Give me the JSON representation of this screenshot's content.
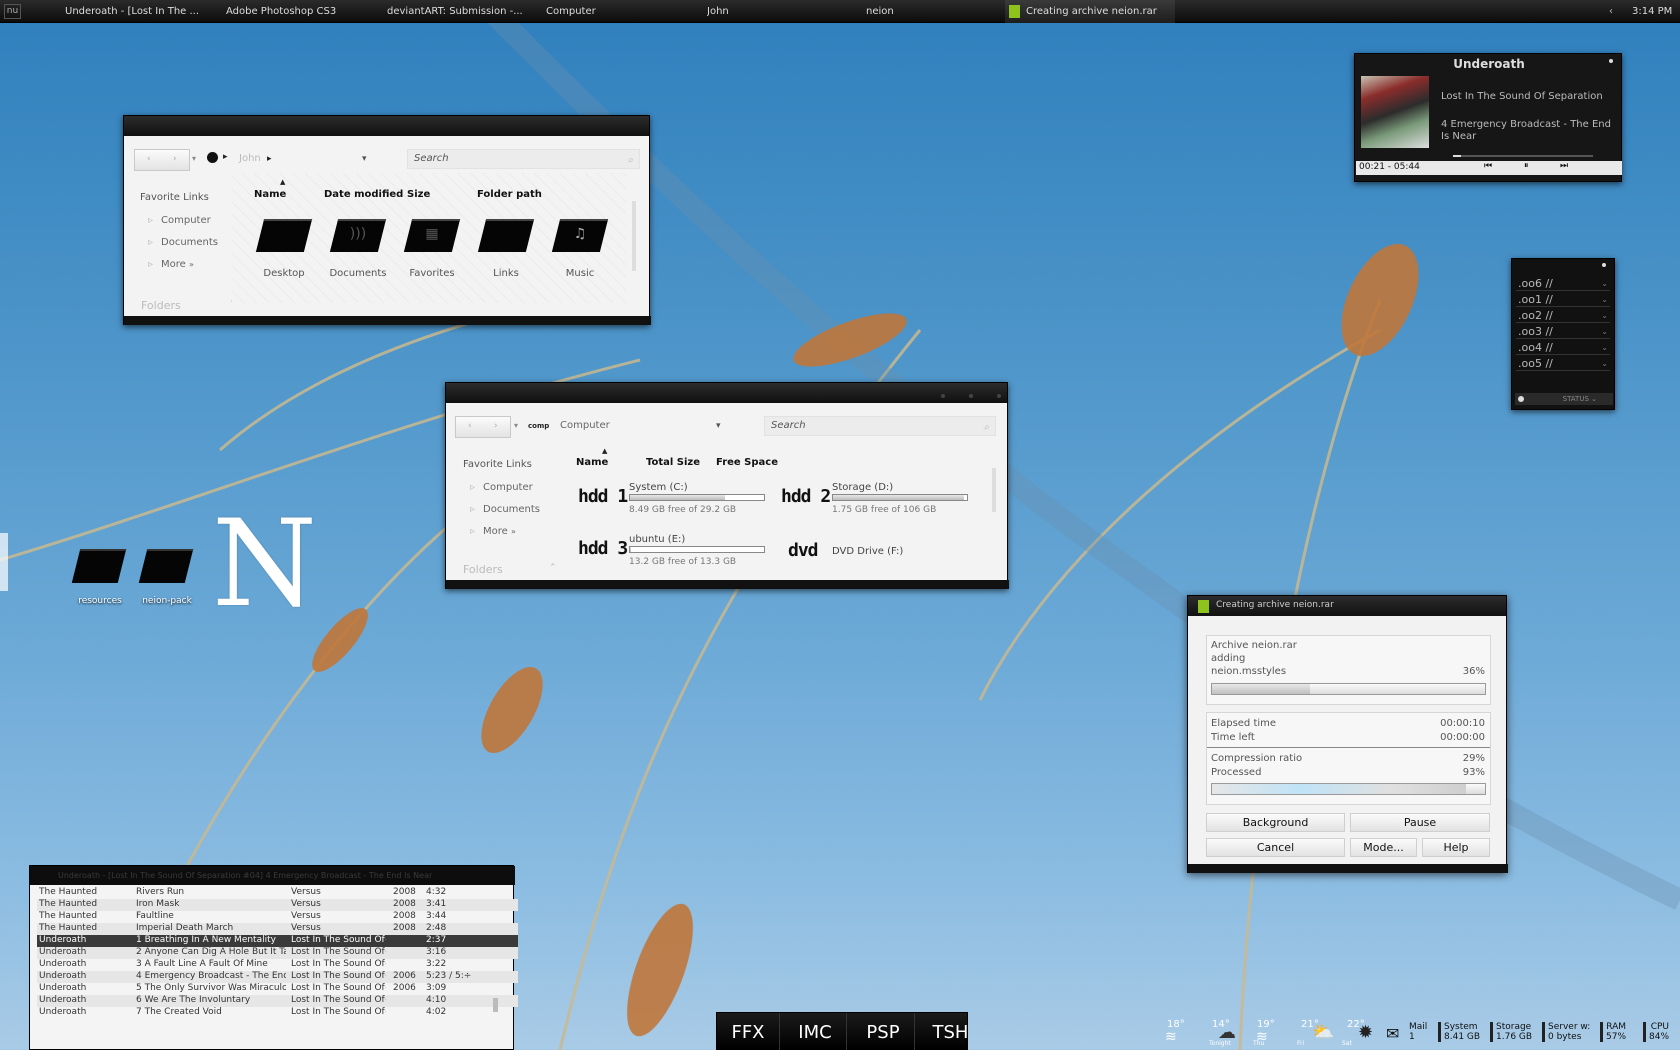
{
  "taskbar": {
    "start_label": "nu",
    "items": [
      {
        "label": "Underoath - [Lost In The ..."
      },
      {
        "label": "Adobe Photoshop CS3"
      },
      {
        "label": "deviantART: Submission -..."
      },
      {
        "label": "Computer"
      },
      {
        "label": "John"
      },
      {
        "label": "neion"
      },
      {
        "label": "Creating archive neion.rar"
      }
    ],
    "clock": "3:14 PM"
  },
  "explorer_john": {
    "address": "John",
    "search_placeholder": "Search",
    "favorite_links_title": "Favorite Links",
    "favorites": [
      "Computer",
      "Documents",
      "More"
    ],
    "columns": [
      "Name",
      "Date modified",
      "Size",
      "Folder path"
    ],
    "items": [
      {
        "label": "Desktop",
        "icon": "folder-icon"
      },
      {
        "label": "Documents",
        "icon": "folder-wifi-icon"
      },
      {
        "label": "Favorites",
        "icon": "folder-windows-icon"
      },
      {
        "label": "Links",
        "icon": "folder-icon"
      },
      {
        "label": "Music",
        "icon": "folder-music-icon"
      }
    ],
    "folders_label": "Folders"
  },
  "explorer_computer": {
    "address_prefix": "comp",
    "address": "Computer",
    "search_placeholder": "Search",
    "favorite_links_title": "Favorite Links",
    "favorites": [
      "Computer",
      "Documents",
      "More"
    ],
    "columns": [
      "Name",
      "Total Size",
      "Free Space"
    ],
    "drives": [
      {
        "icon": "hdd 1",
        "name": "System (C:)",
        "free": "8.49 GB free of 29.2 GB",
        "used_fraction": 0.71
      },
      {
        "icon": "hdd 2",
        "name": "Storage (D:)",
        "free": "1.75 GB free of 106 GB",
        "used_fraction": 0.98
      },
      {
        "icon": "hdd 3",
        "name": "ubuntu (E:)",
        "free": "13.2 GB free of 13.3 GB",
        "used_fraction": 0.01
      },
      {
        "icon": "dvd",
        "name": "DVD Drive (F:)"
      }
    ],
    "folders_label": "Folders"
  },
  "player": {
    "artist": "Underoath",
    "album": "Lost In The Sound Of Separation",
    "track": "4 Emergency Broadcast - The End Is Near",
    "time": "00:21 - 05:44",
    "progress_fraction": 0.06
  },
  "panel": {
    "items": [
      ".oo6 //",
      ".oo1 //",
      ".oo2 //",
      ".oo3 //",
      ".oo4 //",
      ".oo5 //"
    ],
    "status_label": "STATUS"
  },
  "rar": {
    "title": "Creating archive neion.rar",
    "archive": "Archive neion.rar",
    "action": "adding",
    "file": "neion.msstyles",
    "file_percent": "36%",
    "file_progress_fraction": 0.36,
    "elapsed_label": "Elapsed time",
    "elapsed": "00:00:10",
    "left_label": "Time left",
    "left": "00:00:00",
    "ratio_label": "Compression ratio",
    "ratio": "29%",
    "processed_label": "Processed",
    "processed": "93%",
    "processed_fraction": 0.93,
    "buttons": {
      "background": "Background",
      "pause": "Pause",
      "cancel": "Cancel",
      "mode": "Mode...",
      "help": "Help"
    }
  },
  "playlist": {
    "title": "Underoath - [Lost In The Sound Of Separation #04] 4 Emergency Broadcast - The End Is Near",
    "rows": [
      {
        "artist": "The Haunted",
        "title": "Rivers Run",
        "album": "Versus",
        "year": "2008",
        "length": "4:32"
      },
      {
        "artist": "The Haunted",
        "title": "Iron Mask",
        "album": "Versus",
        "year": "2008",
        "length": "3:41"
      },
      {
        "artist": "The Haunted",
        "title": "Faultline",
        "album": "Versus",
        "year": "2008",
        "length": "3:44"
      },
      {
        "artist": "The Haunted",
        "title": "Imperial Death March",
        "album": "Versus",
        "year": "2008",
        "length": "2:48"
      },
      {
        "artist": "Underoath",
        "title": "1 Breathing In A New Mentality",
        "album": "Lost In The Sound Of÷",
        "year": "",
        "length": "2:37"
      },
      {
        "artist": "Underoath",
        "title": "2 Anyone Can Dig A Hole But It Ta÷",
        "album": "Lost In The Sound Of÷",
        "year": "",
        "length": "3:16"
      },
      {
        "artist": "Underoath",
        "title": "3 A Fault Line A Fault Of Mine",
        "album": "Lost In The Sound Of÷",
        "year": "",
        "length": "3:22"
      },
      {
        "artist": "Underoath",
        "title": "4 Emergency Broadcast - The End÷",
        "album": "Lost In The Sound Of÷",
        "year": "2006",
        "length": "5:23 / 5:÷"
      },
      {
        "artist": "Underoath",
        "title": "5 The Only Survivor Was Miraculou÷",
        "album": "Lost In The Sound Of÷",
        "year": "2006",
        "length": "3:09"
      },
      {
        "artist": "Underoath",
        "title": "6 We Are The Involuntary",
        "album": "Lost In The Sound Of÷",
        "year": "",
        "length": "4:10"
      },
      {
        "artist": "Underoath",
        "title": "7 The Created Void",
        "album": "Lost In The Sound Of÷",
        "year": "",
        "length": "4:02"
      }
    ]
  },
  "desktop": {
    "icons": [
      "resources",
      "neion-pack"
    ],
    "logo_letter": "N"
  },
  "dock": {
    "items": [
      "FFX",
      "IMC",
      "PSP",
      "TSH"
    ]
  },
  "tray": {
    "weather": [
      {
        "temp": "18°",
        "day": ""
      },
      {
        "temp": "14°",
        "day": "Tonight"
      },
      {
        "temp": "19°",
        "day": "Thu"
      },
      {
        "temp": "21°",
        "day": "Fri"
      },
      {
        "temp": "22°",
        "day": "Sat"
      }
    ],
    "mail": {
      "label": "Mail",
      "value": "1"
    },
    "system": {
      "label": "System",
      "value": "8.41 GB"
    },
    "storage": {
      "label": "Storage",
      "value": "1.76 GB"
    },
    "server": {
      "label": "Server w:",
      "value": "0 bytes"
    },
    "ram": {
      "label": "RAM",
      "value": "57%"
    },
    "cpu": {
      "label": "CPU",
      "value": "84%"
    }
  },
  "colors": {
    "accent_green": "#8ec21c",
    "chrome_dark": "#111111",
    "sky": "#4a93c8"
  }
}
